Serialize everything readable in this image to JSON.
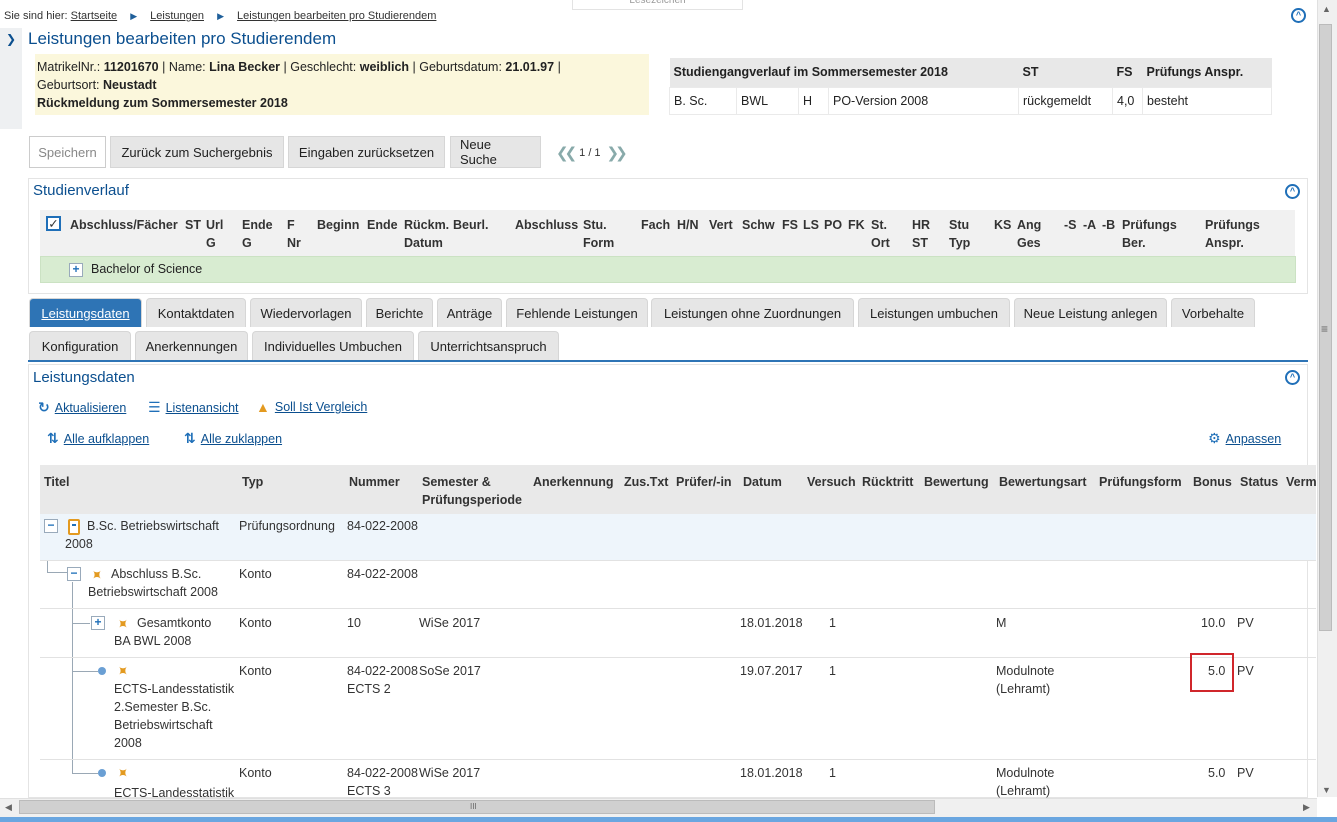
{
  "breadcrumb": {
    "prefix": "Sie sind hier:",
    "items": [
      "Startseite",
      "Leistungen",
      "Leistungen bearbeiten pro Studierendem"
    ]
  },
  "bookmark_tab": "Lesezeichen",
  "page_title": "Leistungen bearbeiten pro Studierendem",
  "student": {
    "matrikel_label": "MatrikelNr.:",
    "matrikel": "11201670",
    "name_label": "Name:",
    "name": "Lina Becker",
    "gender_label": "Geschlecht:",
    "gender": "weiblich",
    "birthdate_label": "Geburtsdatum:",
    "birthdate": "21.01.97",
    "birthplace_label": "Geburtsort:",
    "birthplace": "Neustadt",
    "feedback": "Rückmeldung zum Sommersemester 2018"
  },
  "course_table": {
    "headers": [
      "Studiengangverlauf im Sommersemester 2018",
      "",
      "",
      "",
      "ST",
      "FS",
      "Prüfungs Anspr."
    ],
    "row": [
      "B. Sc.",
      "BWL",
      "H",
      "PO-Version 2008",
      "rückgemeldt",
      "4,0",
      "besteht"
    ]
  },
  "buttons": {
    "save": "Speichern",
    "back": "Zurück zum Suchergebnis",
    "reset": "Eingaben zurücksetzen",
    "new_search": "Neue Suche"
  },
  "pager": {
    "text": "1 / 1"
  },
  "studienverlauf": {
    "title": "Studienverlauf",
    "columns": [
      "Abschluss/Fächer",
      "ST",
      "Url\nG",
      "Ende\nG",
      "F\nNr",
      "Beginn",
      "Ende",
      "Rückm.\nDatum",
      "Beurl.",
      "Abschluss",
      "Stu.\nForm",
      "Fach",
      "H/N",
      "Vert",
      "Schw",
      "FS",
      "LS",
      "PO",
      "FK",
      "St.\nOrt",
      "HR\nST",
      "Stu\nTyp",
      "KS",
      "Ang\nGes",
      "-S",
      "-A",
      "-B",
      "Prüfungs\nBer.",
      "Prüfungs\nAnspr."
    ],
    "row_label": "Bachelor of Science"
  },
  "tabs_row1": [
    "Leistungsdaten",
    "Kontaktdaten",
    "Wiedervorlagen",
    "Berichte",
    "Anträge",
    "Fehlende Leistungen",
    "Leistungen ohne Zuordnungen",
    "Leistungen umbuchen",
    "Neue Leistung anlegen",
    "Vorbehalte"
  ],
  "tabs_row2": [
    "Konfiguration",
    "Anerkennungen",
    "Individuelles Umbuchen",
    "Unterrichtsanspruch"
  ],
  "leistungsdaten": {
    "title": "Leistungsdaten",
    "refresh": "Aktualisieren",
    "list_view": "Listenansicht",
    "target_actual": "Soll Ist Vergleich",
    "expand_all": "Alle aufklappen",
    "collapse_all": "Alle zuklappen",
    "customize": "Anpassen",
    "columns": [
      "Titel",
      "Typ",
      "Nummer",
      "Semester &\nPrüfungsperiode",
      "Anerkennung",
      "Zus.Txt",
      "Prüfer/-in",
      "Datum",
      "Versuch",
      "Rücktritt",
      "Bewertung",
      "Bewertungsart",
      "Prüfungsform",
      "Bonus",
      "Status",
      "Verm"
    ],
    "rows": [
      {
        "title": "B.Sc. Betriebswirtschaft\n2008",
        "type": "Prüfungsordnung",
        "number": "84-022-2008",
        "semester": "",
        "date": "",
        "attempt": "",
        "grading_type": "",
        "bonus": "",
        "status": ""
      },
      {
        "title": "Abschluss B.Sc.\nBetriebswirtschaft 2008",
        "type": "Konto",
        "number": "84-022-2008",
        "semester": "",
        "date": "",
        "attempt": "",
        "grading_type": "",
        "bonus": "",
        "status": ""
      },
      {
        "title": "Gesamtkonto\nBA BWL 2008",
        "type": "Konto",
        "number": "10",
        "semester": "WiSe 2017",
        "date": "18.01.2018",
        "attempt": "1",
        "grading_type": "M",
        "bonus": "10.0",
        "status": "PV"
      },
      {
        "title": "ECTS-Landesstatistik\n2.Semester B.Sc.\nBetriebswirtschaft\n2008",
        "type": "Konto",
        "number": "84-022-2008\nECTS 2",
        "semester": "SoSe 2017",
        "date": "19.07.2017",
        "attempt": "1",
        "grading_type": "Modulnote\n(Lehramt)",
        "bonus": "5.0",
        "status": "PV"
      },
      {
        "title": "ECTS-Landesstatistik",
        "type": "Konto",
        "number": "84-022-2008\nECTS 3",
        "semester": "WiSe 2017",
        "date": "18.01.2018",
        "attempt": "1",
        "grading_type": "Modulnote\n(Lehramt)",
        "bonus": "5.0",
        "status": "PV"
      }
    ]
  },
  "scrollbar": {
    "h_grip": "III",
    "v_grip": "≡"
  }
}
